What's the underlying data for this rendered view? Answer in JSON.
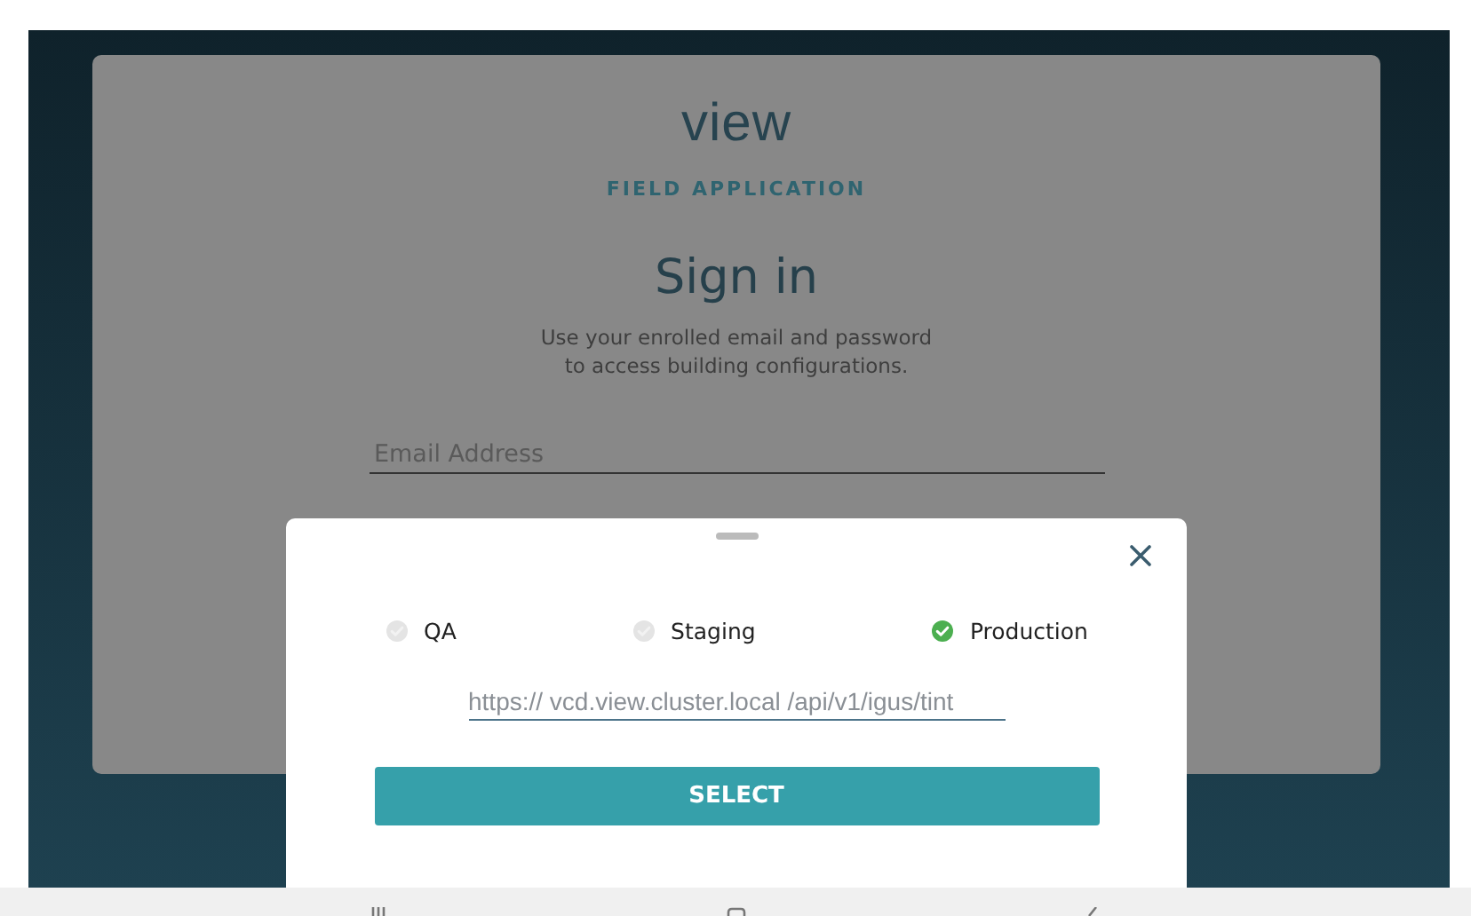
{
  "logo": "view",
  "subtitle": "FIELD APPLICATION",
  "title": "Sign in",
  "description_lines": [
    "Use your enrolled email and password",
    "to access building configurations."
  ],
  "email_field": {
    "placeholder": "Email Address"
  },
  "environment_sheet": {
    "options": [
      {
        "label": "QA",
        "selected": false
      },
      {
        "label": "Staging",
        "selected": false
      },
      {
        "label": "Production",
        "selected": true
      }
    ],
    "url_field": {
      "value": "https:// vcd.view.cluster.local /api/v1/igus/tint"
    },
    "button": "SELECT"
  }
}
